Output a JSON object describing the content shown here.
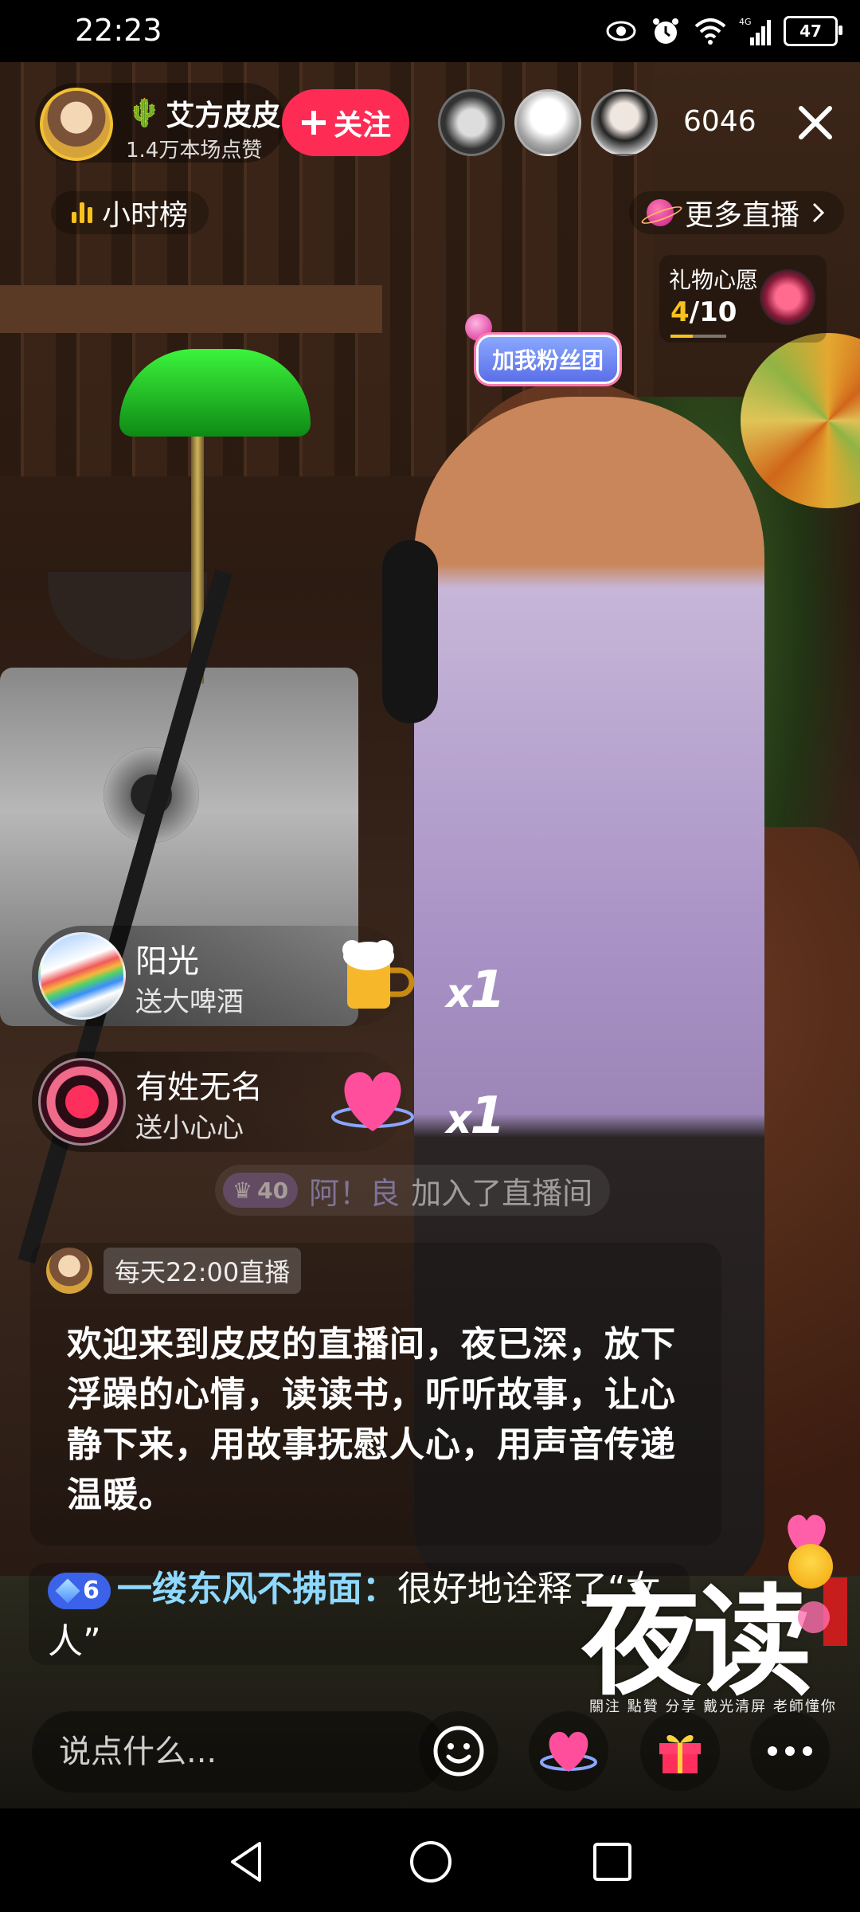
{
  "status_bar": {
    "time": "22:23",
    "battery": "47",
    "icons": [
      "eye-icon",
      "alarm-icon",
      "wifi-icon",
      "signal-4g-icon",
      "battery-icon"
    ]
  },
  "host": {
    "name": "艾方皮皮",
    "likes": "1.4万本场点赞",
    "follow_label": "关注"
  },
  "viewers": {
    "count": "6046"
  },
  "hourly_rank": {
    "label": "小时榜"
  },
  "more_live": {
    "label": "更多直播"
  },
  "gift_wish": {
    "title": "礼物心愿",
    "current": "4",
    "total": "10",
    "progress": 0.4
  },
  "fan_club_tag": "加我粉丝团",
  "gifts": [
    {
      "user": "阳光",
      "desc": "送大啤酒",
      "count": "1"
    },
    {
      "user": "有姓无名",
      "desc": "送小心心",
      "count": "1"
    }
  ],
  "join_notice": {
    "level": "40",
    "user": "阿！良",
    "action": "加入了直播间"
  },
  "announcement": {
    "schedule": "每天22:00直播",
    "text": "欢迎来到皮皮的直播间，夜已深，放下浮躁的心情，读读书，听听故事，让心静下来，用故事抚慰人心，用声音传递温暖。"
  },
  "comment": {
    "level": "6",
    "user": "一缕东风不拂面：",
    "text": "很好地诠释了“女人”"
  },
  "logo": {
    "main": "夜读",
    "sub": "關注 點贊 分享  戴光清屏 老師懂你"
  },
  "bottom_bar": {
    "input_placeholder": "说点什么..."
  },
  "colors": {
    "follow": "#fe2c55",
    "accent_yellow": "#f8c21c",
    "comment_user": "#8fd9ff"
  }
}
